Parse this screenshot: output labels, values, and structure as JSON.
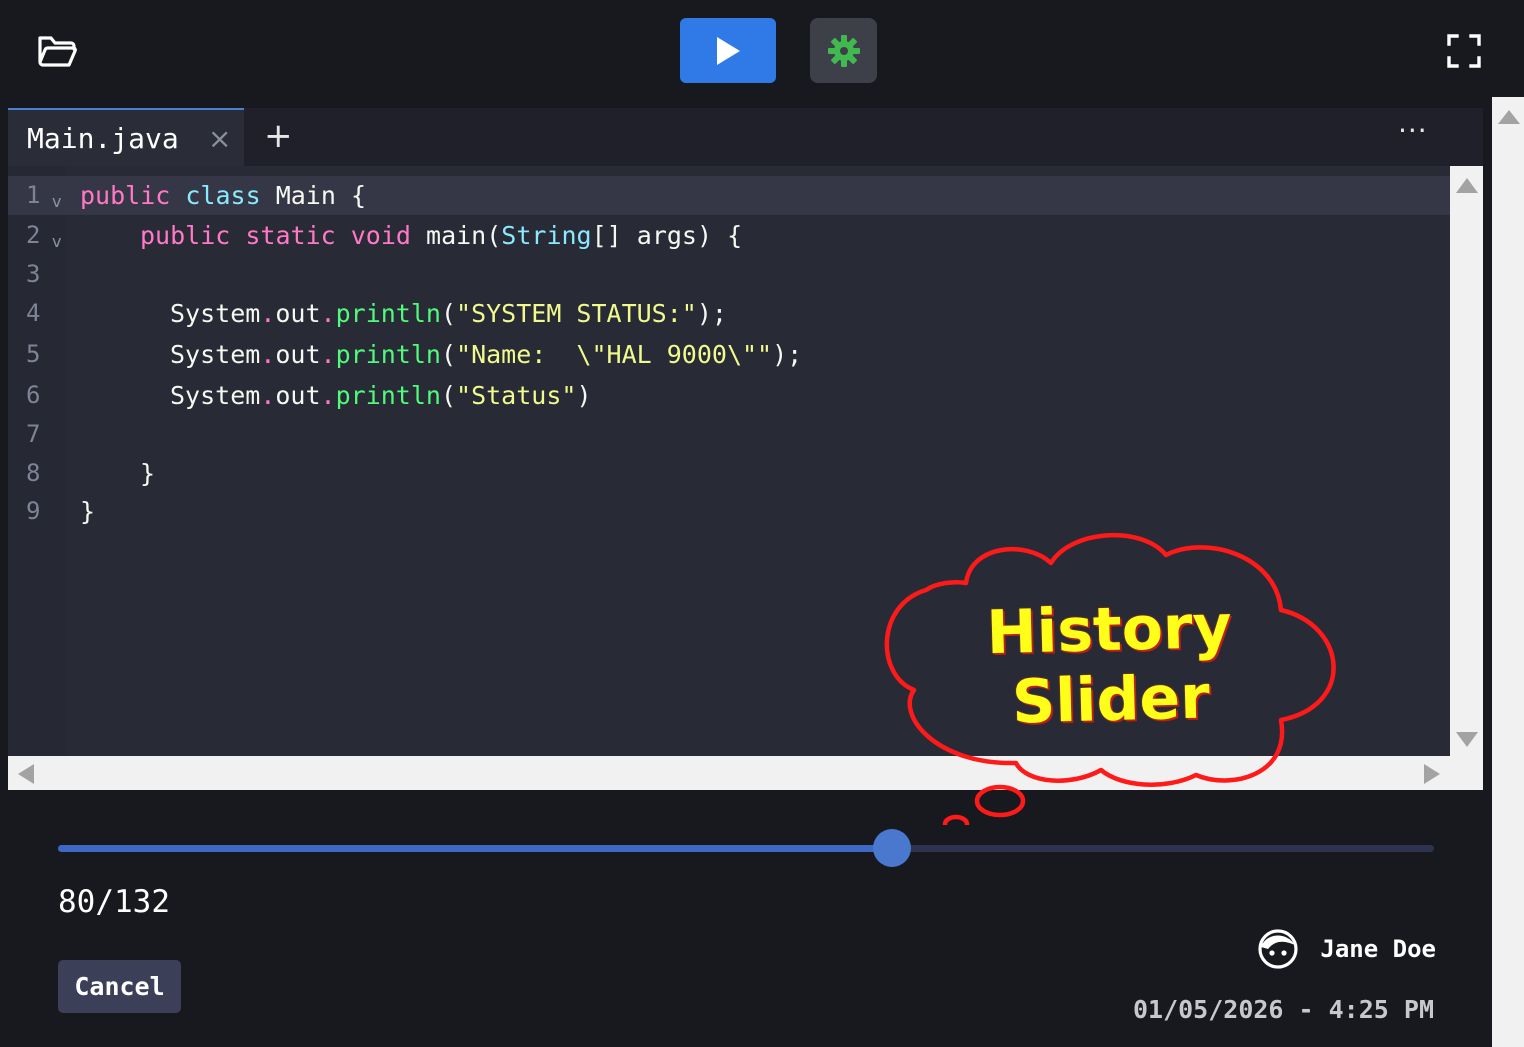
{
  "toolbar": {
    "icons": [
      "folder-open-icon",
      "play-icon",
      "gear-icon",
      "fullscreen-icon"
    ],
    "run_color": "#2f7ae6",
    "debug_icon_color": "#3fb950"
  },
  "tabs": [
    {
      "label": "Main.java",
      "close": "×",
      "active": true
    }
  ],
  "tab_add": "+",
  "tab_more": "···",
  "editor": {
    "language": "java",
    "lines": [
      {
        "n": "1",
        "fold": true
      },
      {
        "n": "2",
        "fold": true
      },
      {
        "n": "3",
        "fold": false
      },
      {
        "n": "4",
        "fold": false
      },
      {
        "n": "5",
        "fold": false
      },
      {
        "n": "6",
        "fold": false
      },
      {
        "n": "7",
        "fold": false
      },
      {
        "n": "8",
        "fold": false
      },
      {
        "n": "9",
        "fold": false
      }
    ],
    "code": {
      "l1": {
        "kw1": "public",
        "kw2": "class",
        "name": "Main",
        "brace": "{"
      },
      "l2": {
        "kw1": "public",
        "kw2": "static",
        "kw3": "void",
        "fn": "main(",
        "type": "String",
        "rest": "[] args) {"
      },
      "l4": {
        "obj": "System",
        "dot1": ".",
        "field": "out",
        "dot2": ".",
        "fn": "println",
        "open": "(",
        "str": "\"SYSTEM STATUS:\"",
        "close": ");"
      },
      "l5": {
        "obj": "System",
        "dot1": ".",
        "field": "out",
        "dot2": ".",
        "fn": "println",
        "open": "(",
        "str": "\"Name:  \\\"HAL 9000\\\"\"",
        "close": ");"
      },
      "l6": {
        "obj": "System",
        "dot1": ".",
        "field": "out",
        "dot2": ".",
        "fn": "println",
        "open": "(",
        "str": "\"Status\"",
        "close": ")"
      },
      "l8": "}",
      "l9": "}"
    }
  },
  "history": {
    "current": 80,
    "total": 132,
    "counter_text": "80/132",
    "cancel_label": "Cancel",
    "author": "Jane Doe",
    "timestamp": "01/05/2026 - 4:25 PM"
  },
  "callout": {
    "text_line1": "History",
    "text_line2": "Slider",
    "stroke_color": "#ff1a1a",
    "text_color": "#ffff1a"
  }
}
